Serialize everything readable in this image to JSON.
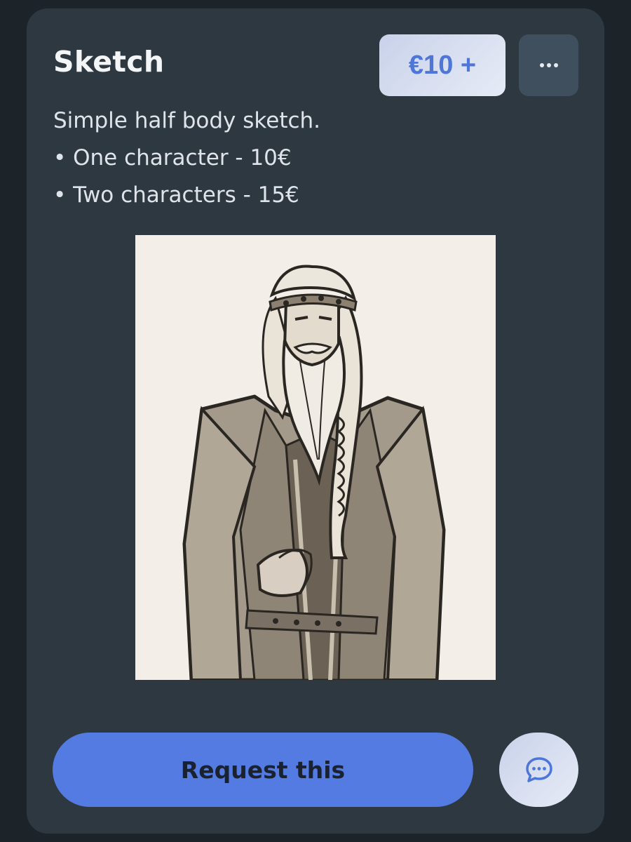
{
  "card": {
    "title": "Sketch",
    "price_label": "€10 +",
    "description": {
      "intro": "Simple half body sketch.",
      "options": [
        "• One character - 10€",
        "• Two characters - 15€"
      ]
    },
    "artwork_icon": "bearded-elder-illustration",
    "request_label": "Request this",
    "more_icon": "more-horizontal-icon",
    "chat_icon": "chat-bubble-icon"
  },
  "colors": {
    "background": "#1c2329",
    "card": "#2d3841",
    "accent": "#547be1",
    "price_text": "#4e76d9",
    "badge_bg": "#dfe5f3"
  }
}
